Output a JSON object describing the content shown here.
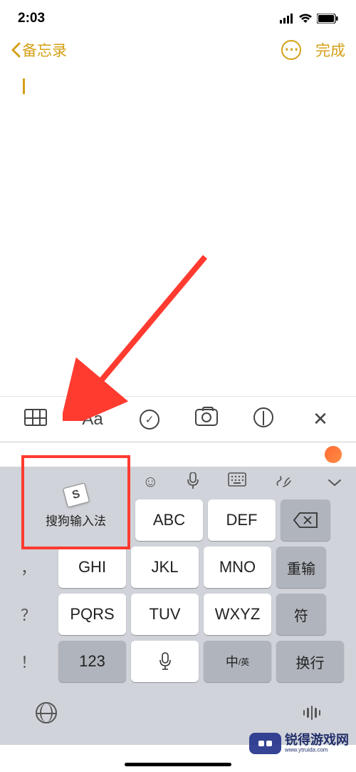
{
  "status": {
    "time": "2:03"
  },
  "nav": {
    "back": "备忘录",
    "done": "完成"
  },
  "toolbar": {
    "aa": "Aa"
  },
  "sogou": {
    "label": "搜狗输入法",
    "logo": "S"
  },
  "keys": {
    "abc": "ABC",
    "def": "DEF",
    "ghi": "GHI",
    "jkl": "JKL",
    "mno": "MNO",
    "pqrs": "PQRS",
    "tuv": "TUV",
    "wxyz": "WXYZ",
    "retype": "重输",
    "symbol": "符",
    "num": "123",
    "lang_main": "中",
    "lang_sub": "/英",
    "enter": "换行",
    "comma": "，",
    "question": "？",
    "exclaim": "！"
  },
  "watermark": {
    "name": "锐得游戏网",
    "url": "www.ytruida.com"
  }
}
